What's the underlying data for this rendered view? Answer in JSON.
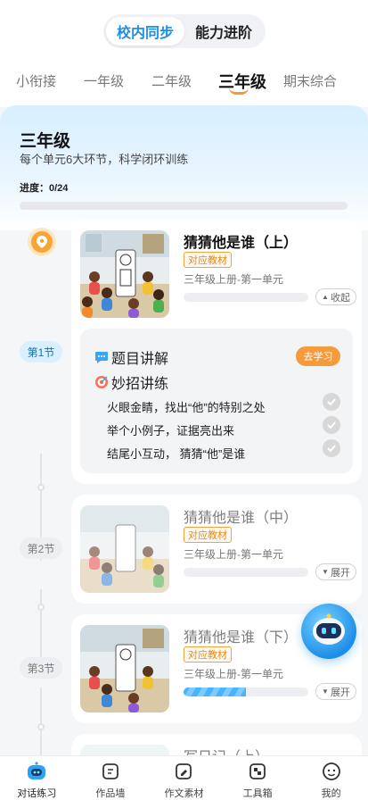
{
  "mode_switch": {
    "options": [
      "校内同步",
      "能力进阶"
    ],
    "active": 0
  },
  "grade_tabs": [
    "小衔接",
    "一年级",
    "二年级",
    "三年级",
    "期末综合"
  ],
  "active_grade": 3,
  "hero": {
    "title": "三年级",
    "subtitle": "每个单元6大环节，科学闭环训练",
    "progress_label": "进度：0/24",
    "progress_fraction": 0
  },
  "sections": [
    "第1节",
    "第2节",
    "第3节"
  ],
  "lessons": [
    {
      "title": "猜猜他是谁（上）",
      "tag": "对应教材",
      "unit": "三年级上册-第一单元",
      "progress_fraction": 0,
      "toggle": "收起",
      "expanded": true
    },
    {
      "title": "猜猜他是谁（中）",
      "tag": "对应教材",
      "unit": "三年级上册-第一单元",
      "progress_fraction": 0,
      "toggle": "展开",
      "expanded": false
    },
    {
      "title": "猜猜他是谁（下）",
      "tag": "对应教材",
      "unit": "三年级上册-第一单元",
      "progress_fraction": 0.5,
      "toggle": "展开",
      "expanded": false
    },
    {
      "title": "写日记（上）"
    }
  ],
  "detail": {
    "explain_label": "题目讲解",
    "go_label": "去学习",
    "practice_label": "妙招讲练",
    "items": [
      "火眼金睛，找出“他”的特别之处",
      "举个小例子，证据亮出来",
      "结尾小互动， 猜猜“他”是谁"
    ]
  },
  "nav": [
    {
      "label": "对话练习",
      "icon": "chat-robot-icon",
      "active": true
    },
    {
      "label": "作品墙",
      "icon": "gallery-icon"
    },
    {
      "label": "作文素材",
      "icon": "material-icon"
    },
    {
      "label": "工具箱",
      "icon": "toolbox-icon"
    },
    {
      "label": "我的",
      "icon": "profile-icon"
    }
  ],
  "colors": {
    "accent": "#1c8ee6",
    "orange": "#f49b3b",
    "progress": "#37a3f2"
  }
}
